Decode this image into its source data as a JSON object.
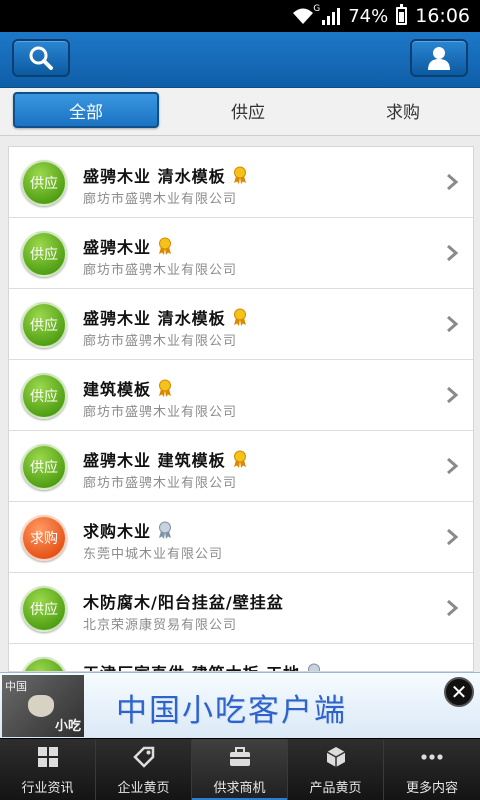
{
  "status_bar": {
    "network": "G",
    "battery": "74%",
    "time": "16:06"
  },
  "top_bar": {
    "search_icon": "search-icon",
    "user_icon": "user-icon"
  },
  "tabs": [
    {
      "label": "全部",
      "active": true
    },
    {
      "label": "供应",
      "active": false
    },
    {
      "label": "求购",
      "active": false
    }
  ],
  "items": [
    {
      "badge": "供应",
      "type": "supply",
      "title": "盛骋木业 清水模板",
      "company": "廊坊市盛骋木业有限公司",
      "medal": "gold"
    },
    {
      "badge": "供应",
      "type": "supply",
      "title": "盛骋木业",
      "company": "廊坊市盛骋木业有限公司",
      "medal": "gold"
    },
    {
      "badge": "供应",
      "type": "supply",
      "title": "盛骋木业 清水模板",
      "company": "廊坊市盛骋木业有限公司",
      "medal": "gold"
    },
    {
      "badge": "供应",
      "type": "supply",
      "title": "建筑模板",
      "company": "廊坊市盛骋木业有限公司",
      "medal": "gold"
    },
    {
      "badge": "供应",
      "type": "supply",
      "title": "盛骋木业 建筑模板",
      "company": "廊坊市盛骋木业有限公司",
      "medal": "gold"
    },
    {
      "badge": "求购",
      "type": "buy",
      "title": "求购木业",
      "company": "东莞中城木业有限公司",
      "medal": "silver"
    },
    {
      "badge": "供应",
      "type": "supply",
      "title": "木防腐木/阳台挂盆/壁挂盆",
      "company": "北京荣源康贸易有限公司",
      "medal": ""
    },
    {
      "badge": "供应",
      "type": "supply",
      "title": "天津厂家直供 建筑木板 工地",
      "company": "",
      "medal": "silver"
    }
  ],
  "ad": {
    "thumb_top": "中国",
    "thumb_bottom": "小吃",
    "text": "中国小吃客户端",
    "close": "✕"
  },
  "bottom_nav": [
    {
      "label": "行业资讯",
      "icon": "grid-icon",
      "active": false
    },
    {
      "label": "企业黄页",
      "icon": "tag-icon",
      "active": false
    },
    {
      "label": "供求商机",
      "icon": "briefcase-icon",
      "active": true
    },
    {
      "label": "产品黄页",
      "icon": "cube-icon",
      "active": false
    },
    {
      "label": "更多内容",
      "icon": "more-icon",
      "active": false
    }
  ],
  "colors": {
    "header_blue": "#1566b5",
    "supply_green": "#5cae1a",
    "buy_orange": "#ee6424",
    "nav_dark": "#1f1f1f"
  }
}
